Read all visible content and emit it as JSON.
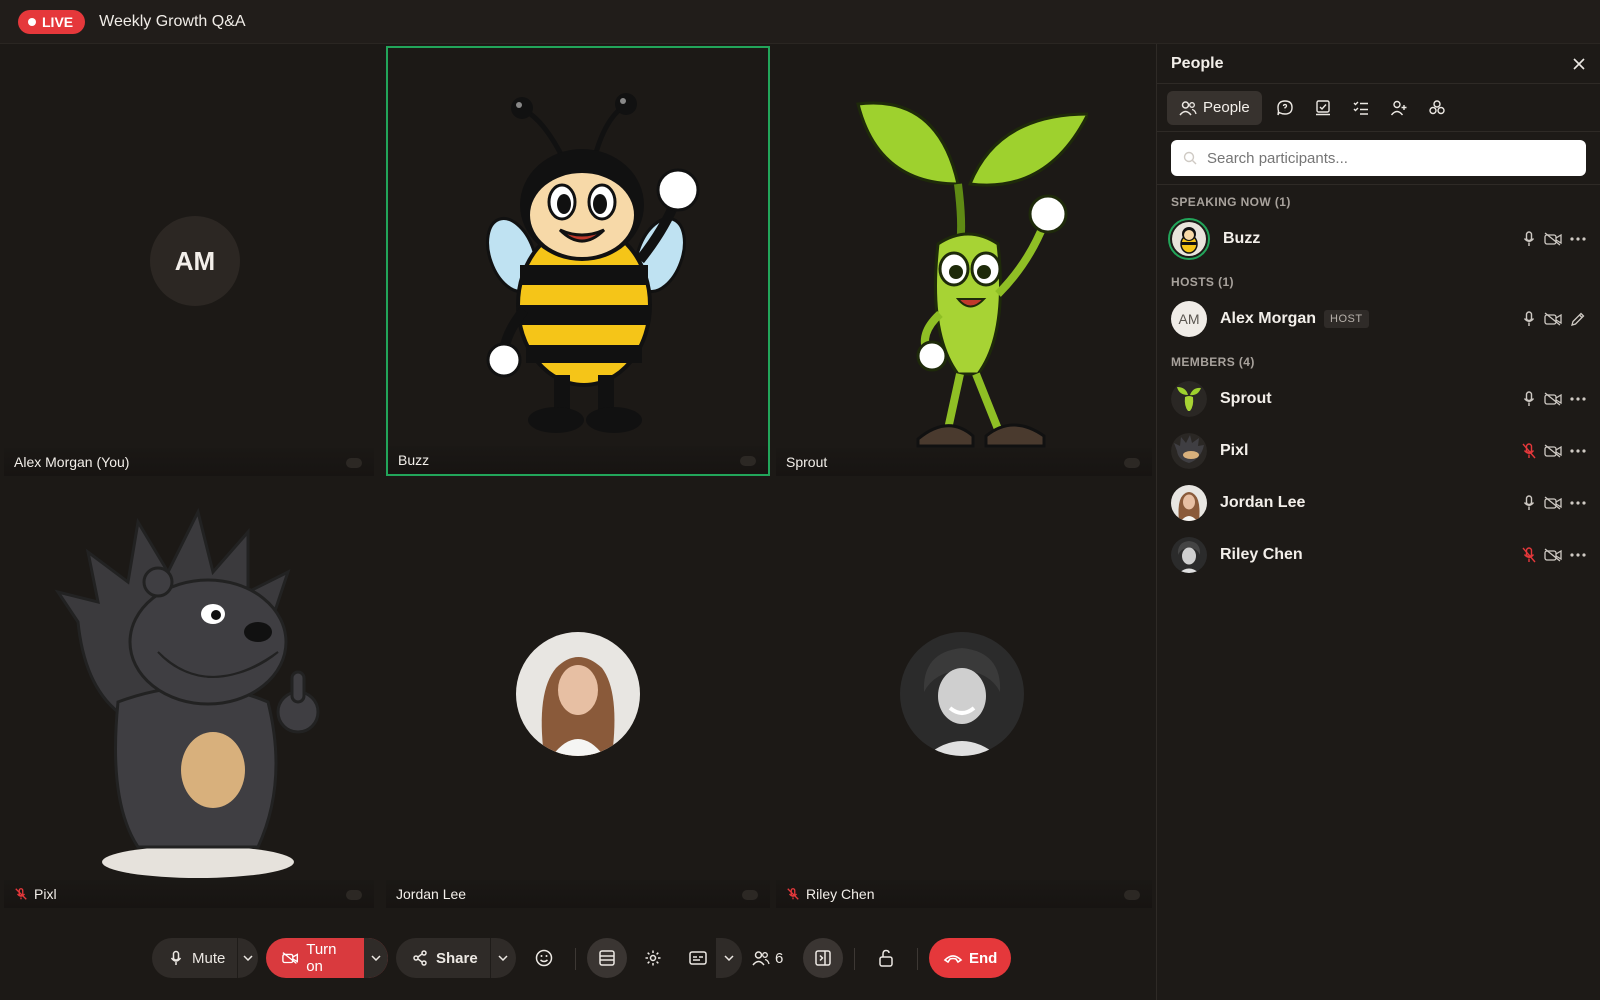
{
  "topbar": {
    "live_label": "LIVE",
    "meeting_title": "Weekly Growth Q&A"
  },
  "tiles": [
    {
      "name": "Alex Morgan (You)",
      "initials": "AM",
      "muted": false
    },
    {
      "name": "Buzz",
      "speaking": true,
      "muted": false
    },
    {
      "name": "Sprout",
      "muted": false
    },
    {
      "name": "Pixl",
      "muted": true
    },
    {
      "name": "Jordan Lee",
      "muted": false
    },
    {
      "name": "Riley Chen",
      "muted": true
    }
  ],
  "controls": {
    "mute_label": "Mute",
    "camera_label": "Turn on",
    "share_label": "Share",
    "participant_count": "6",
    "end_label": "End"
  },
  "panel": {
    "title": "People",
    "active_tab": "People",
    "search_placeholder": "Search participants...",
    "sections": {
      "speaking": "SPEAKING NOW (1)",
      "hosts": "HOSTS (1)",
      "members": "MEMBERS (4)"
    },
    "speaking": [
      {
        "name": "Buzz"
      }
    ],
    "hosts": [
      {
        "name": "Alex Morgan",
        "initials": "AM",
        "badge": "HOST"
      }
    ],
    "members": [
      {
        "name": "Sprout",
        "muted": false
      },
      {
        "name": "Pixl",
        "muted": true
      },
      {
        "name": "Jordan Lee",
        "muted": false
      },
      {
        "name": "Riley Chen",
        "muted": true
      }
    ]
  },
  "colors": {
    "live": "#e5383b",
    "speaking_ring": "#22a55a",
    "muted_icon": "#e5383b",
    "background": "#1c1916"
  }
}
